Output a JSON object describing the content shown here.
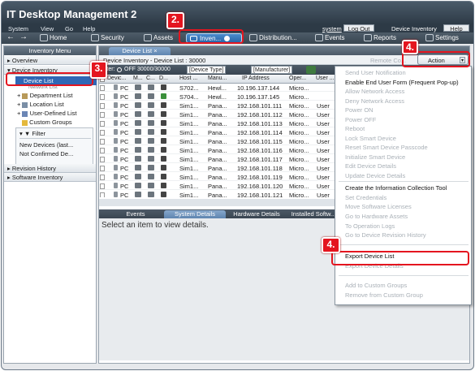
{
  "app": {
    "title": "IT Desktop Management 2"
  },
  "menu": {
    "items": [
      "System",
      "View",
      "Go",
      "Help"
    ],
    "user": "system",
    "logout": "Log Out",
    "context": "Device Inventory",
    "help": "Help"
  },
  "toolbar": {
    "home": "Home",
    "security": "Security",
    "assets": "Assets",
    "inventory": "Inven...",
    "distribution": "Distribution...",
    "events": "Events",
    "reports": "Reports",
    "settings": "Settings"
  },
  "annotations": {
    "step2": "2.",
    "step3": "3.",
    "step4a": "4.",
    "step4b": "4."
  },
  "left": {
    "header": "Inventory Menu",
    "overview": "Overview",
    "device_inventory": "Device Inventory",
    "device_list": "Device List",
    "network_list": "Network List",
    "department_list": "Department List",
    "location_list": "Location List",
    "user_defined_list": "User-Defined List",
    "custom_groups": "Custom Groups",
    "filter": "Filter",
    "filter_new": "New Devices (last...",
    "filter_unconfirmed": "Not Confirmed De...",
    "revision_history": "Revision History",
    "software_inventory": "Software Inventory"
  },
  "main": {
    "tab": "Device List",
    "info": "Device Inventory - Device List : 30000",
    "remote_control": "Remote Co...",
    "filter_label": "Filter:",
    "filter_state": "OFF",
    "filter_count": "30000/30000",
    "filter_device_type": "[Device Type]",
    "filter_manufacturer": "[Manufacturer]",
    "columns": [
      "Devic...",
      "M...",
      "C...",
      "D...",
      "Host ...",
      "Manu...",
      "IP Address",
      "Oper...",
      "User ..."
    ],
    "rows": [
      {
        "type": "PC",
        "host": "S702...",
        "manu": "Hewl...",
        "ip": "10.196.137.144",
        "os": "Micro...",
        "user": ""
      },
      {
        "type": "PC",
        "host": "S704...",
        "manu": "Hewl...",
        "ip": "10.196.137.145",
        "os": "Micro...",
        "user": ""
      },
      {
        "type": "PC",
        "host": "Sim1...",
        "manu": "Pana...",
        "ip": "192.168.101.111",
        "os": "Micro...",
        "user": "User"
      },
      {
        "type": "PC",
        "host": "Sim1...",
        "manu": "Pana...",
        "ip": "192.168.101.112",
        "os": "Micro...",
        "user": "User"
      },
      {
        "type": "PC",
        "host": "Sim1...",
        "manu": "Pana...",
        "ip": "192.168.101.113",
        "os": "Micro...",
        "user": "User"
      },
      {
        "type": "PC",
        "host": "Sim1...",
        "manu": "Pana...",
        "ip": "192.168.101.114",
        "os": "Micro...",
        "user": "User"
      },
      {
        "type": "PC",
        "host": "Sim1...",
        "manu": "Pana...",
        "ip": "192.168.101.115",
        "os": "Micro...",
        "user": "User"
      },
      {
        "type": "PC",
        "host": "Sim1...",
        "manu": "Pana...",
        "ip": "192.168.101.116",
        "os": "Micro...",
        "user": "User"
      },
      {
        "type": "PC",
        "host": "Sim1...",
        "manu": "Pana...",
        "ip": "192.168.101.117",
        "os": "Micro...",
        "user": "User"
      },
      {
        "type": "PC",
        "host": "Sim1...",
        "manu": "Pana...",
        "ip": "192.168.101.118",
        "os": "Micro...",
        "user": "User"
      },
      {
        "type": "PC",
        "host": "Sim1...",
        "manu": "Pana...",
        "ip": "192.168.101.119",
        "os": "Micro...",
        "user": "User"
      },
      {
        "type": "PC",
        "host": "Sim1...",
        "manu": "Pana...",
        "ip": "192.168.101.120",
        "os": "Micro...",
        "user": "User"
      },
      {
        "type": "PC",
        "host": "Sim1...",
        "manu": "Pana...",
        "ip": "192.168.101.121",
        "os": "Micro...",
        "user": "User"
      }
    ],
    "bottom_tabs": [
      "Events",
      "System Details",
      "Hardware Details",
      "Installed Softw..."
    ],
    "detail_placeholder": "Select an item to view details."
  },
  "action_menu": {
    "button": "Action",
    "items": [
      {
        "label": "Send User Notification",
        "enabled": false
      },
      {
        "label": "Enable End User Form (Frequent Pop-up)",
        "enabled": true
      },
      {
        "label": "Allow Network Access",
        "enabled": false
      },
      {
        "label": "Deny Network Access",
        "enabled": false
      },
      {
        "label": "Power ON",
        "enabled": false
      },
      {
        "label": "Power OFF",
        "enabled": false
      },
      {
        "label": "Reboot",
        "enabled": false
      },
      {
        "label": "Lock Smart Device",
        "enabled": false
      },
      {
        "label": "Reset Smart Device Passcode",
        "enabled": false
      },
      {
        "label": "Initialize Smart Device",
        "enabled": false
      },
      {
        "label": "Edit Device Details",
        "enabled": false
      },
      {
        "label": "Update Device Details",
        "enabled": false
      },
      {
        "label": "Create the Information Collection Tool",
        "enabled": true
      },
      {
        "label": "Set Credentials",
        "enabled": false
      },
      {
        "label": "Move Software Licenses",
        "enabled": false
      },
      {
        "label": "Go to Hardware Assets",
        "enabled": false
      },
      {
        "label": "To Operation Logs",
        "enabled": false
      },
      {
        "label": "Go to Device Revision History",
        "enabled": false
      },
      {
        "label": "Export Device List",
        "enabled": true
      },
      {
        "label": "Export Device Details",
        "enabled": false
      },
      {
        "label": "Add to Custom Groups",
        "enabled": false
      },
      {
        "label": "Remove from Custom Group",
        "enabled": false
      }
    ]
  },
  "colors": {
    "highlight": "#e4151f",
    "selection": "#2f67b5",
    "chrome": "#3a4754"
  }
}
